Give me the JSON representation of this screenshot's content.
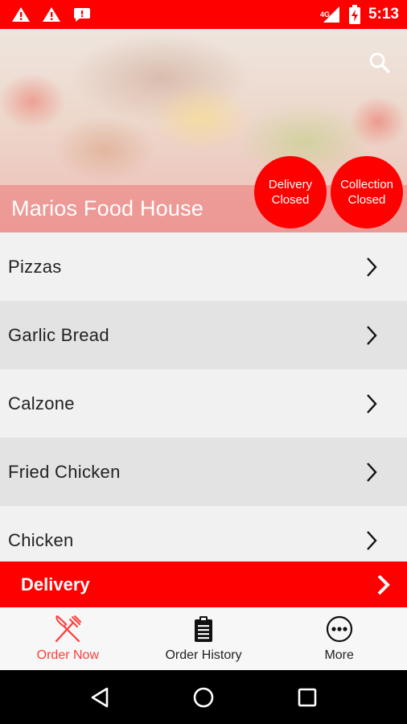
{
  "status_bar": {
    "time": "5:13",
    "network": "4G",
    "icons": [
      "warning-icon",
      "warning-icon",
      "chat-alert-icon",
      "signal-icon",
      "battery-charging-icon"
    ]
  },
  "header": {
    "restaurant_name": "Marios Food House",
    "delivery_badge": {
      "line1": "Delivery",
      "line2": "Closed"
    },
    "collection_badge": {
      "line1": "Collection",
      "line2": "Closed"
    },
    "search_icon": "search-icon"
  },
  "menu": {
    "items": [
      {
        "label": "Pizzas"
      },
      {
        "label": "Garlic Bread"
      },
      {
        "label": "Calzone"
      },
      {
        "label": "Fried Chicken"
      },
      {
        "label": "Chicken"
      }
    ]
  },
  "delivery_bar": {
    "label": "Delivery"
  },
  "bottom_nav": {
    "items": [
      {
        "label": "Order Now",
        "icon": "fork-knife-icon",
        "active": true
      },
      {
        "label": "Order History",
        "icon": "clipboard-icon",
        "active": false
      },
      {
        "label": "More",
        "icon": "more-icon",
        "active": false
      }
    ]
  },
  "colors": {
    "accent": "#ff0000",
    "active_tab": "#ff3b3b",
    "list_odd": "#f1f1f1",
    "list_even": "#e3e3e3"
  }
}
